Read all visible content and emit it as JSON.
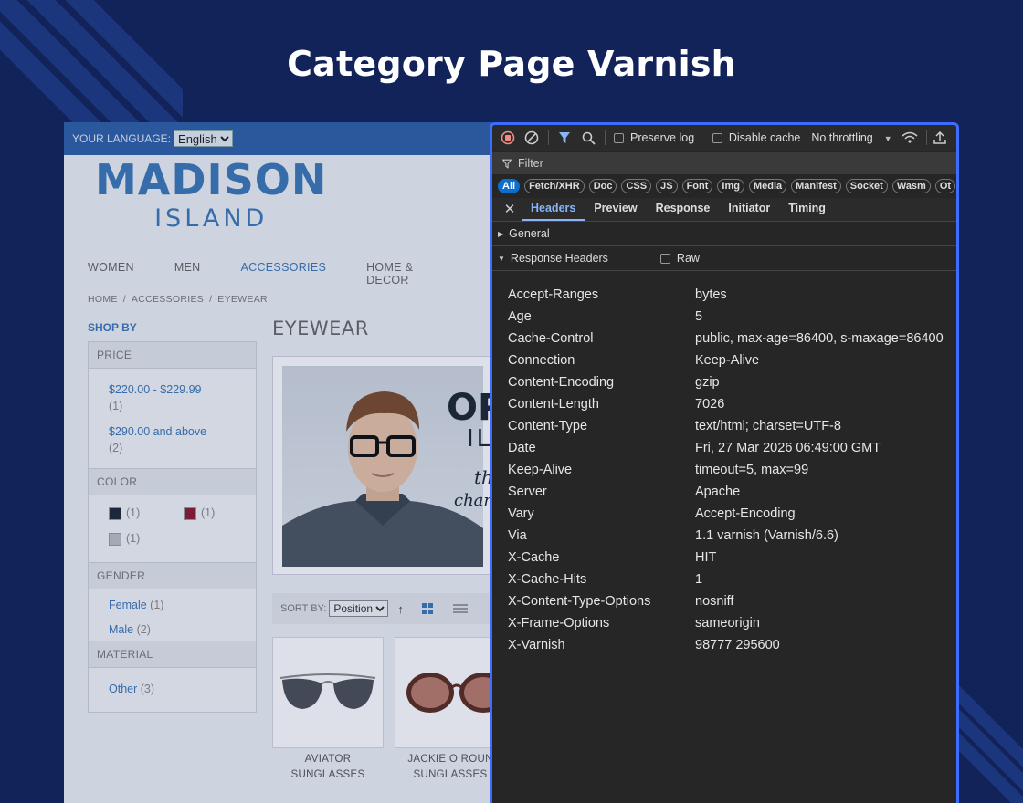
{
  "banner": {
    "title": "Category Page Varnish"
  },
  "shop": {
    "language_label": "YOUR LANGUAGE:",
    "language_value": "English",
    "logo_line1": "MADISON",
    "logo_line2": "ISLAND",
    "nav": [
      "WOMEN",
      "MEN",
      "ACCESSORIES",
      "HOME & DECOR"
    ],
    "active_nav": "ACCESSORIES",
    "breadcrumb": [
      "HOME",
      "ACCESSORIES",
      "EYEWEAR"
    ],
    "breadcrumb_sep": "/",
    "shop_by": "SHOP BY",
    "filters": {
      "price": {
        "title": "PRICE",
        "items": [
          {
            "label": "$220.00 - $229.99",
            "count": "(1)"
          },
          {
            "label": "$290.00 and above",
            "count": "(2)"
          }
        ]
      },
      "color": {
        "title": "COLOR",
        "swatches": [
          {
            "color": "#1f2a3a",
            "count": "(1)"
          },
          {
            "color": "#8b1d34",
            "count": "(1)"
          },
          {
            "color": "#b8bcc2",
            "count": "(1)"
          }
        ]
      },
      "gender": {
        "title": "GENDER",
        "items": [
          {
            "label": "Female",
            "count": "(1)"
          },
          {
            "label": "Male",
            "count": "(2)"
          }
        ]
      },
      "material": {
        "title": "MATERIAL",
        "items": [
          {
            "label": "Other",
            "count": "(3)"
          }
        ]
      }
    },
    "category_title": "EYEWEAR",
    "hero_text": {
      "line1": "OP",
      "line2": "IL",
      "line3": "th",
      "line4": "char"
    },
    "sort_label": "SORT BY:",
    "sort_value": "Position",
    "products": [
      {
        "name_line1": "AVIATOR",
        "name_line2": "SUNGLASSES"
      },
      {
        "name_line1": "JACKIE O ROUN",
        "name_line2": "SUNGLASSES"
      }
    ]
  },
  "devtools": {
    "toolbar": {
      "preserve_log": "Preserve log",
      "disable_cache": "Disable cache",
      "throttling": "No throttling"
    },
    "filter_placeholder": "Filter",
    "chips": [
      "All",
      "Fetch/XHR",
      "Doc",
      "CSS",
      "JS",
      "Font",
      "Img",
      "Media",
      "Manifest",
      "Socket",
      "Wasm",
      "Ot"
    ],
    "tabs": [
      "Headers",
      "Preview",
      "Response",
      "Initiator",
      "Timing"
    ],
    "sections": {
      "general": "General",
      "response_headers": "Response Headers",
      "raw": "Raw"
    },
    "headers": [
      {
        "key": "Accept-Ranges",
        "value": "bytes"
      },
      {
        "key": "Age",
        "value": "5"
      },
      {
        "key": "Cache-Control",
        "value": "public, max-age=86400, s-maxage=86400"
      },
      {
        "key": "Connection",
        "value": "Keep-Alive"
      },
      {
        "key": "Content-Encoding",
        "value": "gzip"
      },
      {
        "key": "Content-Length",
        "value": "7026"
      },
      {
        "key": "Content-Type",
        "value": "text/html; charset=UTF-8"
      },
      {
        "key": "Date",
        "value": "Fri, 27 Mar 2026 06:49:00 GMT"
      },
      {
        "key": "Keep-Alive",
        "value": "timeout=5, max=99"
      },
      {
        "key": "Server",
        "value": "Apache"
      },
      {
        "key": "Vary",
        "value": "Accept-Encoding"
      },
      {
        "key": "Via",
        "value": "1.1 varnish (Varnish/6.6)"
      },
      {
        "key": "X-Cache",
        "value": "HIT"
      },
      {
        "key": "X-Cache-Hits",
        "value": "1"
      },
      {
        "key": "X-Content-Type-Options",
        "value": "nosniff"
      },
      {
        "key": "X-Frame-Options",
        "value": "sameorigin"
      },
      {
        "key": "X-Varnish",
        "value": "98777 295600"
      }
    ]
  }
}
